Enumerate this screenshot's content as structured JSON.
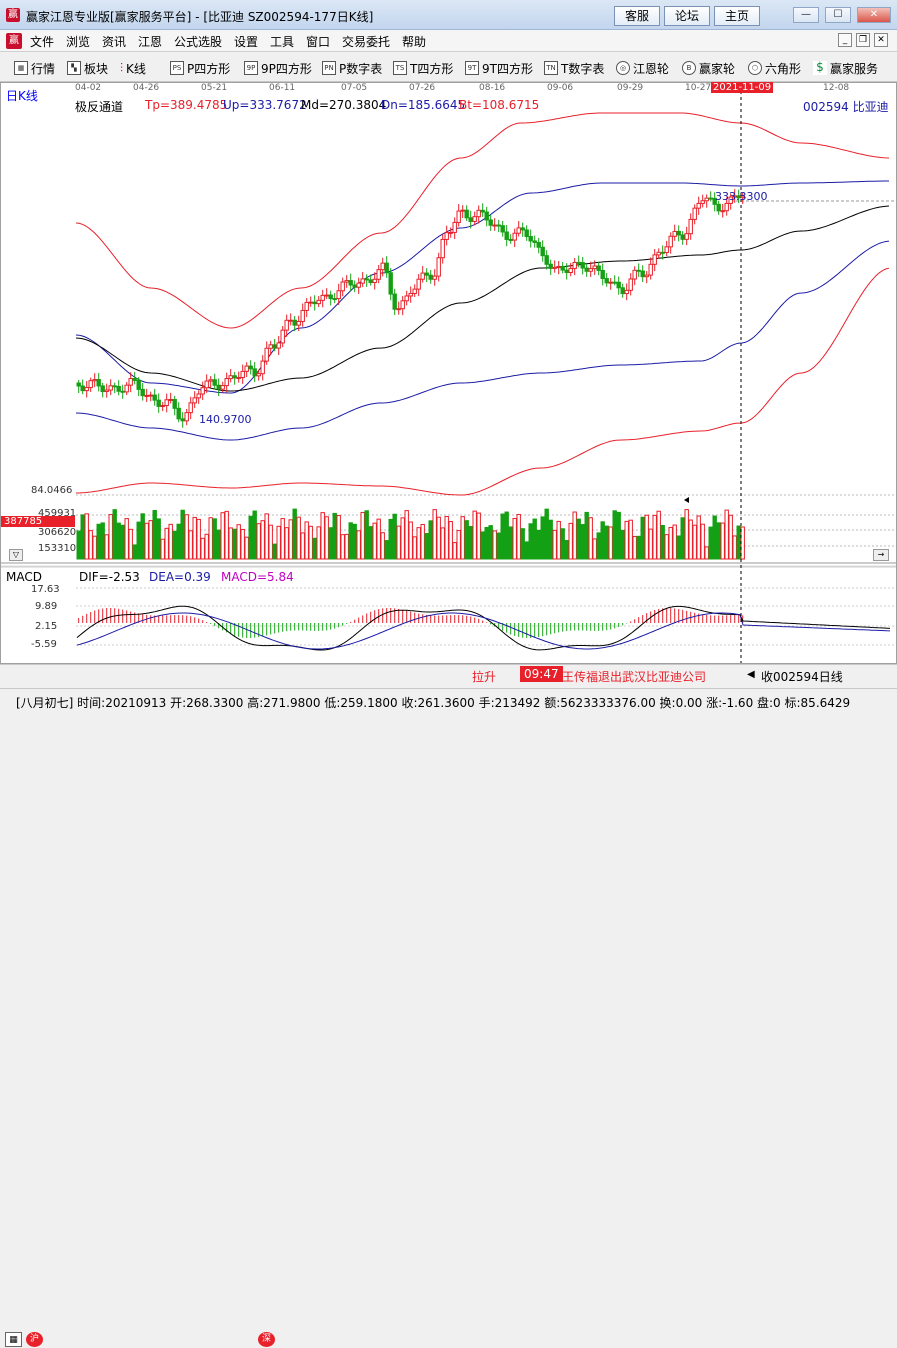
{
  "window": {
    "title": "赢家江恩专业版[赢家服务平台] - [比亚迪  SZ002594-177日K线]",
    "logo": "赢",
    "buttons": [
      "客服",
      "论坛",
      "主页"
    ],
    "controls": [
      "minimize",
      "maximize",
      "close"
    ]
  },
  "menu": {
    "logo": "赢",
    "items": [
      "文件",
      "浏览",
      "资讯",
      "江恩",
      "公式选股",
      "设置",
      "工具",
      "窗口",
      "交易委托",
      "帮助"
    ]
  },
  "toolbar": {
    "items": [
      {
        "label": "行情",
        "icon": "grid-icon"
      },
      {
        "label": "板块",
        "icon": "blocks-icon"
      },
      {
        "label": "K线",
        "icon": "candlestick-icon"
      },
      {
        "label": "P四方形",
        "icon": "p-square-icon",
        "glyph": "PS"
      },
      {
        "label": "9P四方形",
        "icon": "9p-square-icon",
        "glyph": "9P"
      },
      {
        "label": "P数字表",
        "icon": "p-table-icon",
        "glyph": "PN"
      },
      {
        "label": "T四方形",
        "icon": "t-square-icon",
        "glyph": "TS"
      },
      {
        "label": "9T四方形",
        "icon": "9t-square-icon",
        "glyph": "9T"
      },
      {
        "label": "T数字表",
        "icon": "t-table-icon",
        "glyph": "TN"
      },
      {
        "label": "江恩轮",
        "icon": "gann-wheel-icon",
        "glyph": "◎"
      },
      {
        "label": "赢家轮",
        "icon": "winner-wheel-icon",
        "glyph": "B"
      },
      {
        "label": "六角形",
        "icon": "hexagon-icon",
        "glyph": "⬡"
      },
      {
        "label": "赢家服务",
        "icon": "service-icon",
        "glyph": "$"
      }
    ]
  },
  "chart": {
    "period_label": "日K线",
    "date_ticks": [
      "04-02",
      "04-26",
      "05-21",
      "06-11",
      "07-05",
      "07-26",
      "08-16",
      "09-06",
      "09-29",
      "10-27",
      "12-08"
    ],
    "cursor_date": "2021-11-09",
    "indicator": {
      "name": "极反通道",
      "items": [
        {
          "label": "Tp=389.4785",
          "color": "#e8202a"
        },
        {
          "label": "Up=333.7672",
          "color": "#1b1ba6"
        },
        {
          "label": "Md=270.3804",
          "color": "#000000"
        },
        {
          "label": "Dn=185.6645",
          "color": "#1b1ba6"
        },
        {
          "label": "Bt=108.6715",
          "color": "#e8202a"
        }
      ]
    },
    "stock": "002594  比亚迪",
    "price_annotations": {
      "high": "333.3300",
      "low": "140.9700"
    },
    "volume": {
      "max_label": "84.0466",
      "levels": [
        "459931",
        "306620",
        "153310"
      ],
      "cursor_value": "387785"
    },
    "macd": {
      "name": "MACD",
      "dif": "DIF=-2.53",
      "dea": "DEA=0.39",
      "macd": "MACD=5.84",
      "levels": [
        "17.63",
        "9.89",
        "2.15",
        "-5.59"
      ]
    },
    "colors": {
      "up": "#e8202a",
      "down": "#14a014",
      "channel_outer": "#e8202a",
      "channel_inner": "#1b1ba6",
      "channel_mid": "#000000"
    }
  },
  "status": {
    "ticker_label": "拉升",
    "ticker_time": "09:47",
    "ticker_news": "王传福退出武汉比亚迪公司",
    "stock_label": "收002594日线"
  },
  "bottom": {
    "text": "[八月初七] 时间:20210913 开:268.3300 高:271.9800 低:259.1800 收:261.3600 手:213492 额:5623333376.00 换:0.00 涨:-1.60 盘:0 标:85.6429"
  }
}
